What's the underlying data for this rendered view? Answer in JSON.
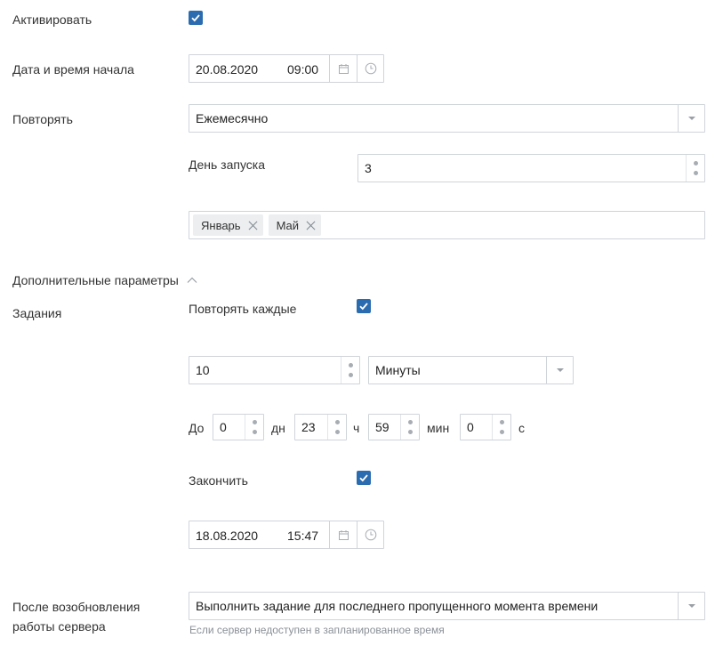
{
  "activate": {
    "label": "Активировать",
    "checked": true
  },
  "start": {
    "label": "Дата и время начала",
    "date": "20.08.2020",
    "time": "09:00",
    "calendar_icon": "calendar-icon",
    "clock_icon": "clock-icon"
  },
  "repeat": {
    "label": "Повторять",
    "value": "Ежемесячно"
  },
  "launch_day": {
    "label": "День запуска",
    "value": "3"
  },
  "months": {
    "tags": [
      "Январь",
      "Май"
    ]
  },
  "advanced": {
    "label": "Дополнительные параметры",
    "expanded": true
  },
  "tasks": {
    "label": "Задания",
    "repeat_every": {
      "label": "Повторять каждые",
      "checked": true
    },
    "interval": {
      "value": "10",
      "unit": "Минуты"
    },
    "until": {
      "prefix": "До",
      "days": "0",
      "days_unit": "дн",
      "hours": "23",
      "hours_unit": "ч",
      "minutes": "59",
      "minutes_unit": "мин",
      "seconds": "0",
      "seconds_unit": "с"
    },
    "finish": {
      "label": "Закончить",
      "checked": true,
      "date": "18.08.2020",
      "time": "15:47"
    }
  },
  "after_restart": {
    "label_line1": "После возобновления",
    "label_line2": "работы сервера",
    "value": "Выполнить задание для последнего пропущенного момента времени",
    "hint": "Если сервер недоступен в запланированное время"
  },
  "colors": {
    "accent": "#2b6cb0",
    "border": "#cfd4da"
  }
}
